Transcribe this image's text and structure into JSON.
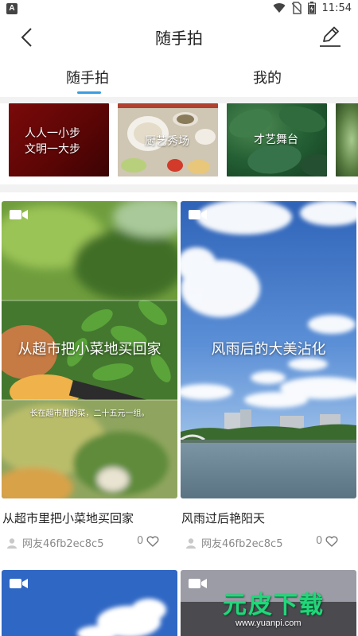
{
  "status_bar": {
    "time": "11:54",
    "app_badge": "A"
  },
  "header": {
    "title": "随手拍"
  },
  "tabs": [
    {
      "label": "随手拍",
      "active": true
    },
    {
      "label": "我的",
      "active": false
    }
  ],
  "banners": [
    {
      "line1": "人人一小步",
      "line2": "文明一大步"
    },
    {
      "label": "厨艺秀场"
    },
    {
      "label": "才艺舞台"
    }
  ],
  "posts": [
    {
      "overlay_title": "从超市把小菜地买回家",
      "overlay_subtitle": "长在超市里的菜，二十五元一组。",
      "caption": "从超市里把小菜地买回家",
      "author": "网友46fb2ec8c5",
      "likes": "0"
    },
    {
      "overlay_title": "风雨后的大美沾化",
      "caption": "风雨过后艳阳天",
      "author": "网友46fb2ec8c5",
      "likes": "0"
    }
  ],
  "watermark": {
    "text": "元皮下载",
    "url": "www.yuanpi.com"
  },
  "colors": {
    "accent": "#3a9de0",
    "muted_text": "#8a8a8a",
    "watermark_green": "#22d67a"
  }
}
